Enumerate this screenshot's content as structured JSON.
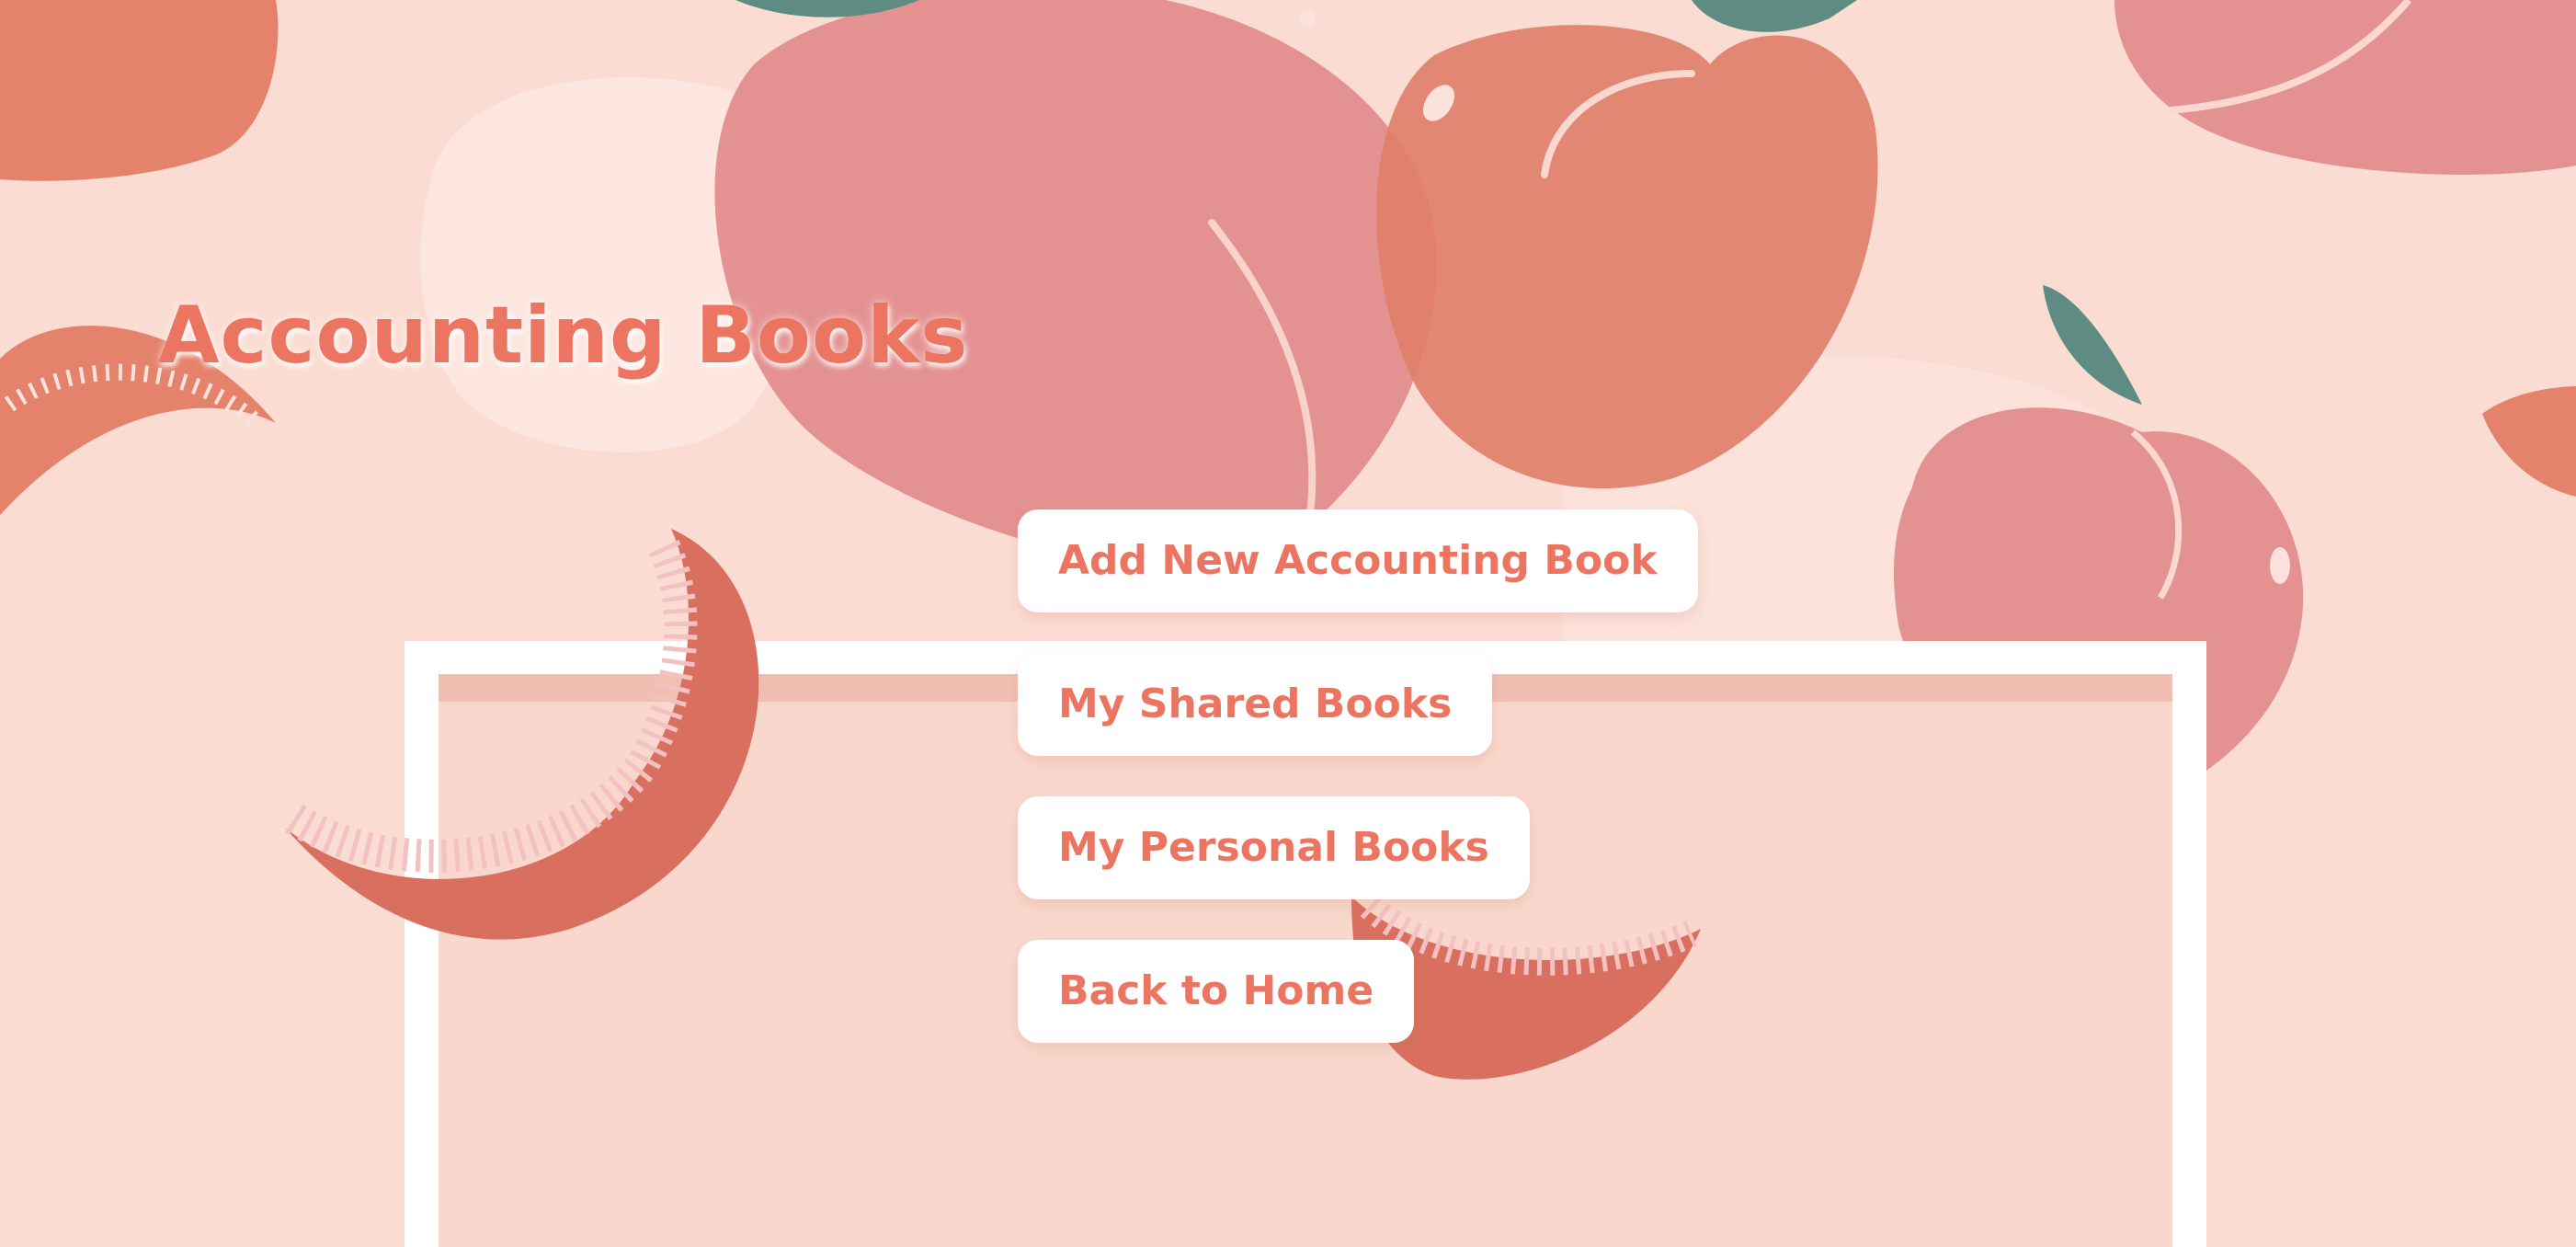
{
  "page": {
    "title": "Accounting Books"
  },
  "menu": {
    "items": [
      {
        "label": "Add New Accounting Book"
      },
      {
        "label": "My Shared Books"
      },
      {
        "label": "My Personal Books"
      },
      {
        "label": "Back to Home"
      }
    ]
  },
  "colors": {
    "background": "#fbdcd2",
    "accent_text": "#ec7561",
    "button_bg": "#ffffff",
    "peach_pink": "#e58f8d",
    "peach_coral": "#e07f6a",
    "leaf_teal": "#5f8c82"
  }
}
